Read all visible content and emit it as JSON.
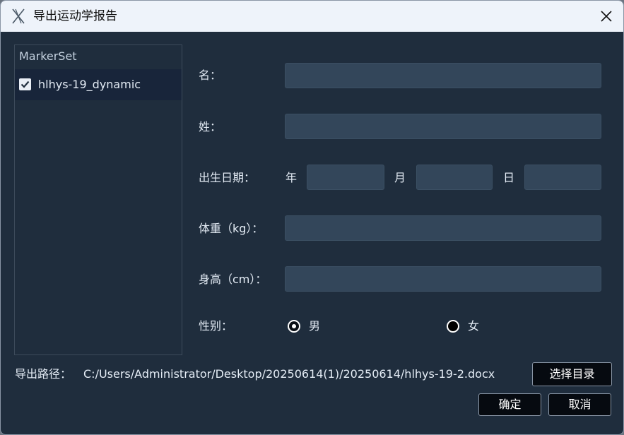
{
  "window": {
    "title": "导出运动学报告"
  },
  "icons": {
    "app": "app-logo-icon",
    "close": "close-icon",
    "check": "checkmark-icon"
  },
  "markerset": {
    "header": "MarkerSet",
    "items": [
      {
        "label": "hlhys-19_dynamic",
        "checked": true
      }
    ]
  },
  "form": {
    "first_name_label": "名：",
    "first_name_value": "",
    "last_name_label": "姓：",
    "last_name_value": "",
    "birth_label": "出生日期：",
    "year_label": "年",
    "year_value": "",
    "month_label": "月",
    "month_value": "",
    "day_label": "日",
    "day_value": "",
    "weight_label": "体重（kg）：",
    "weight_value": "",
    "height_label": "身高（cm）：",
    "height_value": "",
    "gender_label": "性别：",
    "gender_options": [
      "男",
      "女"
    ],
    "gender_selected": "男"
  },
  "export": {
    "path_label": "导出路径：",
    "path_value": "C:/Users/Administrator/Desktop/20250614(1)/20250614/hlhys-19-2.docx",
    "choose_dir_label": "选择目录"
  },
  "buttons": {
    "ok_label": "确定",
    "cancel_label": "取消"
  },
  "colors": {
    "background": "#1f2d3d",
    "field": "#33465a",
    "titlebar": "#eef3fa"
  }
}
